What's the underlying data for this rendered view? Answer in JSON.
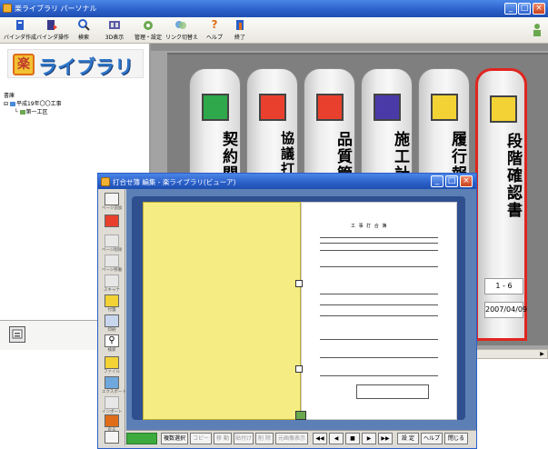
{
  "main_window": {
    "title": "楽ライブラリ パーソナル"
  },
  "toolbar": {
    "items": [
      {
        "label": "バインダ作成",
        "icon": "binder-create-icon"
      },
      {
        "label": "バインダ操作",
        "icon": "binder-operate-icon"
      },
      {
        "label": "検索",
        "icon": "search-icon"
      },
      {
        "label": "3D表示",
        "icon": "3d-view-icon"
      },
      {
        "label": "管理・設定",
        "icon": "settings-icon"
      },
      {
        "label": "リンク切替え",
        "icon": "link-switch-icon"
      },
      {
        "label": "ヘルプ",
        "icon": "help-icon"
      },
      {
        "label": "終了",
        "icon": "exit-icon"
      }
    ]
  },
  "logo": {
    "mark": "楽",
    "name": "ライブラリ"
  },
  "tree": {
    "root": "書庫",
    "project": "平成19年〇〇工事",
    "section": "第一工区"
  },
  "binders": [
    {
      "label": "契約関係",
      "color": "#2ea84a"
    },
    {
      "label": "協議打合せ簿",
      "color": "#e8402c"
    },
    {
      "label": "品質管理",
      "color": "#e8402c"
    },
    {
      "label": "施工計画書",
      "color": "#4a3aa8"
    },
    {
      "label": "履行報告書",
      "color": "#f2d235"
    },
    {
      "label": "段階確認書",
      "color": "#f2d235",
      "selected": true,
      "number": "1 - 6",
      "date": "2007/04/09"
    }
  ],
  "viewer": {
    "title": "打合せ簿  編集 - 楽ライブラリ(ビューア)",
    "side_buttons": [
      {
        "label": "ページ追加"
      },
      {
        "label": "",
        "icon": "pdf-icon"
      },
      {
        "label": "ページ削除"
      },
      {
        "label": "ページ移動"
      },
      {
        "label": "スキャナ"
      },
      {
        "label": "付箋"
      },
      {
        "label": "印刷"
      },
      {
        "label": "検索"
      },
      {
        "label": "ファイル"
      },
      {
        "label": "エクスポート"
      },
      {
        "label": "インポート"
      },
      {
        "label": "戻る"
      },
      {
        "label": "バインダ"
      }
    ],
    "document": {
      "title": "工 事 打 合 簿"
    },
    "bottom_buttons": [
      {
        "label": "複数選択",
        "disabled": false
      },
      {
        "label": "コピー",
        "disabled": true
      },
      {
        "label": "移 動",
        "disabled": true
      },
      {
        "label": "貼付け",
        "disabled": true
      },
      {
        "label": "削 除",
        "disabled": true
      },
      {
        "label": "元画像表示",
        "disabled": true
      },
      {
        "label": "◀◀",
        "disabled": false
      },
      {
        "label": "◀",
        "disabled": false
      },
      {
        "label": "■",
        "disabled": false
      },
      {
        "label": "▶",
        "disabled": false
      },
      {
        "label": "▶▶",
        "disabled": false
      },
      {
        "label": "設 定",
        "disabled": false
      },
      {
        "label": "ヘルプ",
        "disabled": false
      },
      {
        "label": "閉じる",
        "disabled": false
      }
    ]
  },
  "colors": {
    "title_bar": "#2a5fc8",
    "shelf": "#a3a3a3",
    "page_yellow": "#f5ec84",
    "selected_binder_border": "#e0251f"
  }
}
